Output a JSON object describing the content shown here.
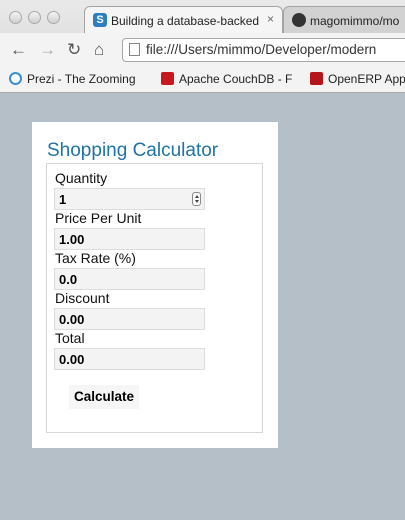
{
  "browser": {
    "tabs": [
      {
        "title": "Building a database-backed",
        "favicon_letter": "S",
        "close": "×"
      },
      {
        "title": "magomimmo/mo",
        "favicon_letter": ""
      }
    ],
    "url": "file:///Users/mimmo/Developer/modern",
    "bookmarks": [
      {
        "label": "Prezi - The Zooming"
      },
      {
        "label": "Apache CouchDB - F"
      },
      {
        "label": "OpenERP App"
      }
    ]
  },
  "calculator": {
    "title": "Shopping Calculator",
    "fields": [
      {
        "label": "Quantity",
        "value": "1"
      },
      {
        "label": "Price Per Unit",
        "value": "1.00"
      },
      {
        "label": "Tax Rate (%)",
        "value": "0.0"
      },
      {
        "label": "Discount",
        "value": "0.00"
      },
      {
        "label": "Total",
        "value": "0.00"
      }
    ],
    "button_label": "Calculate"
  }
}
